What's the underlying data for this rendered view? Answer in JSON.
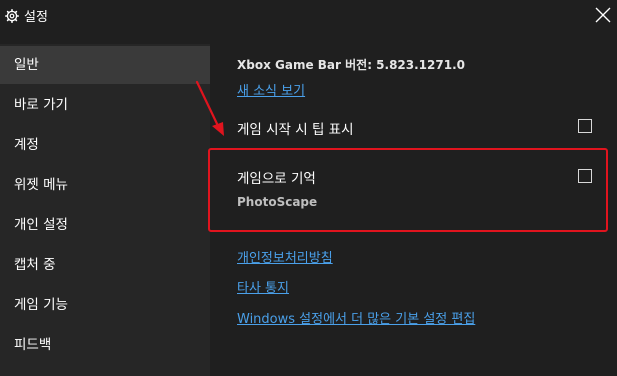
{
  "window": {
    "title": "설정"
  },
  "sidebar": {
    "items": [
      {
        "label": "일반"
      },
      {
        "label": "바로 가기"
      },
      {
        "label": "계정"
      },
      {
        "label": "위젯 메뉴"
      },
      {
        "label": "개인 설정"
      },
      {
        "label": "캡처 중"
      },
      {
        "label": "게임 기능"
      },
      {
        "label": "피드백"
      }
    ],
    "selected": "일반"
  },
  "general": {
    "version_text": "Xbox Game Bar 버전: 5.823.1271.0",
    "whats_new_link": "새 소식 보기",
    "show_tips_label": "게임 시작 시 팁 표시",
    "show_tips_checked": false,
    "remember_game_label": "게임으로 기억",
    "remember_game_checked": false,
    "current_app": "PhotoScape",
    "privacy_link": "개인정보처리방침",
    "third_party_link": "타사 통지",
    "windows_settings_link": "Windows 설정에서 더 많은 기본 설정 편집"
  },
  "annotation": {
    "highlight_color": "#e0141e"
  },
  "colors": {
    "background": "#1f1f1f",
    "sidebar": "#262626",
    "selected": "#3a3a3a",
    "link": "#4aa0ea"
  }
}
